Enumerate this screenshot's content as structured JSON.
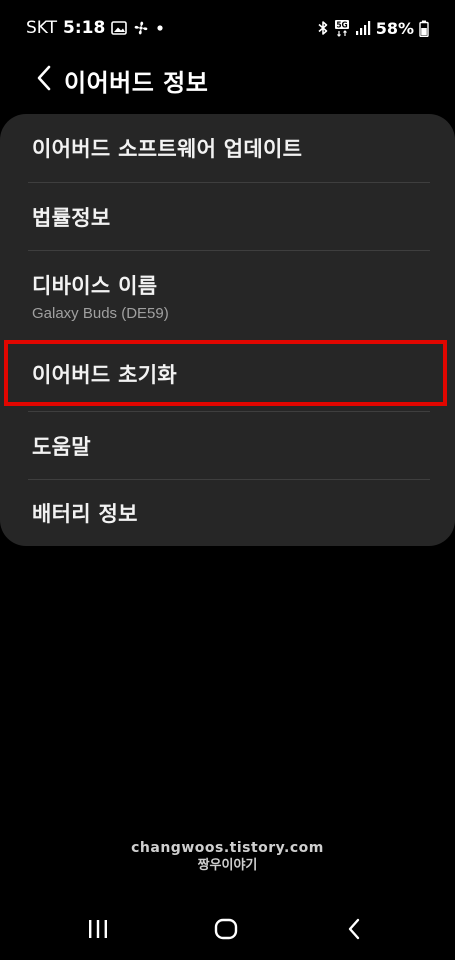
{
  "status_bar": {
    "carrier": "SKT",
    "time": "5:18",
    "battery": "58%",
    "icons_left": [
      "image-icon",
      "fan-icon",
      "dot-icon"
    ],
    "icons_right": [
      "bluetooth-icon",
      "5g-icon",
      "signal-icon",
      "battery-icon"
    ]
  },
  "header": {
    "title": "이어버드 정보",
    "back_icon": "chevron-left-icon"
  },
  "menu": {
    "items": [
      {
        "label": "이어버드 소프트웨어 업데이트"
      },
      {
        "label": "법률정보"
      },
      {
        "label": "디바이스 이름",
        "sub": "Galaxy Buds (DE59)"
      },
      {
        "label": "이어버드 초기화"
      },
      {
        "label": "도움말"
      },
      {
        "label": "배터리 정보"
      }
    ],
    "highlight_color": "#e10600"
  },
  "watermark": {
    "line1": "changwoos.tistory.com",
    "line2": "짱우이야기"
  },
  "nav_bar": {
    "icons": [
      "recent-apps-icon",
      "home-icon",
      "back-icon"
    ]
  },
  "colors": {
    "background": "#000000",
    "card": "#262626",
    "divider": "#3e3e3e",
    "text": "#f2f2f2",
    "subtext": "#a0a0a0"
  }
}
